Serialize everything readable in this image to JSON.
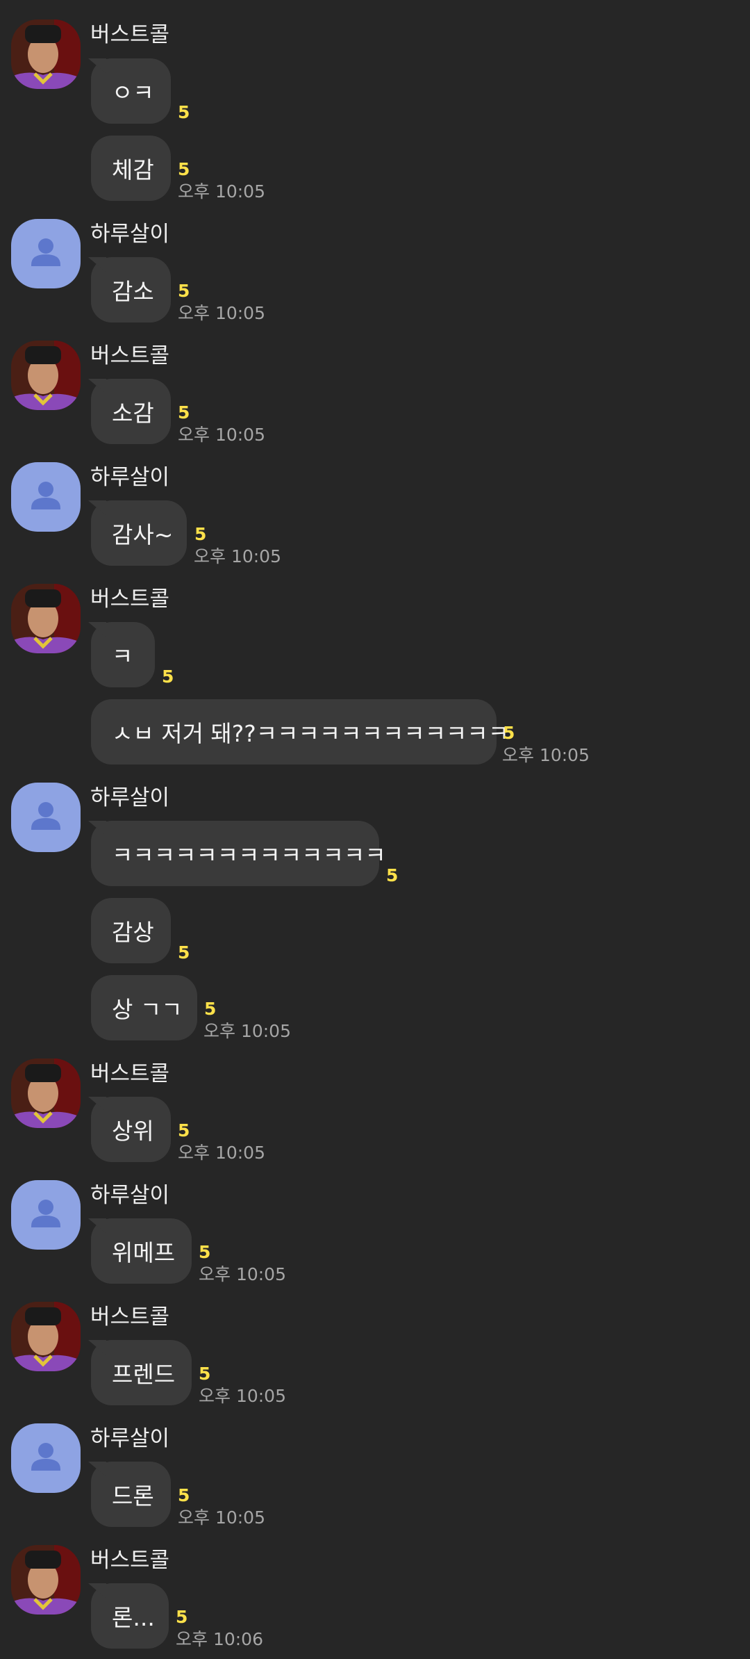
{
  "theme": {
    "background": "#262626",
    "bubble": "#3a3a3a",
    "unread": "#ffe14a",
    "time": "#a6a6a6",
    "default_avatar": "#8ea3e3"
  },
  "participants": {
    "bustcol": {
      "name": "버스트콜",
      "avatar": "photo-avatar"
    },
    "haru": {
      "name": "하루살이",
      "avatar": "person-icon"
    }
  },
  "messages": [
    {
      "text": "ㅇㅋ",
      "unread": "5"
    },
    {
      "text": "체감",
      "unread": "5",
      "time": "오후 10:05"
    },
    {
      "text": "감소",
      "unread": "5",
      "time": "오후 10:05"
    },
    {
      "text": "소감",
      "unread": "5",
      "time": "오후 10:05"
    },
    {
      "text": "감사~",
      "unread": "5",
      "time": "오후 10:05"
    },
    {
      "text": "ㅋ",
      "unread": "5"
    },
    {
      "text": "ㅅㅂ 저거 돼??ㅋㅋㅋㅋㅋㅋㅋㅋㅋㅋㅋㅋ",
      "unread": "5",
      "time": "오후 10:05"
    },
    {
      "text": "ㅋㅋㅋㅋㅋㅋㅋㅋㅋㅋㅋㅋㅋ",
      "unread": "5"
    },
    {
      "text": "감상",
      "unread": "5"
    },
    {
      "text": "상 ㄱㄱ",
      "unread": "5",
      "time": "오후 10:05"
    },
    {
      "text": "상위",
      "unread": "5",
      "time": "오후 10:05"
    },
    {
      "text": "위메프",
      "unread": "5",
      "time": "오후 10:05"
    },
    {
      "text": "프렌드",
      "unread": "5",
      "time": "오후 10:05"
    },
    {
      "text": "드론",
      "unread": "5",
      "time": "오후 10:05"
    },
    {
      "text": "론...",
      "unread": "5",
      "time": "오후 10:06"
    }
  ]
}
